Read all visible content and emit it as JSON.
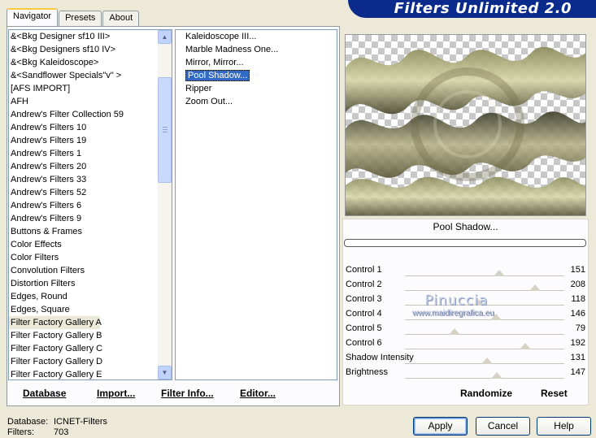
{
  "tabs": [
    "Navigator",
    "Presets",
    "About"
  ],
  "banner_title": "Filters Unlimited 2.0",
  "categories": [
    "&<Bkg Designer sf10 III>",
    "&<Bkg Designers sf10 IV>",
    "&<Bkg Kaleidoscope>",
    "&<Sandflower Specials\"v\" >",
    "[AFS IMPORT]",
    "AFH",
    "Andrew's Filter Collection 59",
    "Andrew's Filters 10",
    "Andrew's Filters 19",
    "Andrew's Filters 1",
    "Andrew's Filters 20",
    "Andrew's Filters 33",
    "Andrew's Filters 52",
    "Andrew's Filters 6",
    "Andrew's Filters 9",
    "Buttons & Frames",
    "Color Effects",
    "Color Filters",
    "Convolution Filters",
    "Distortion Filters",
    "Edges, Round",
    "Edges, Square",
    "Filter Factory Gallery A",
    "Filter Factory Gallery B",
    "Filter Factory Gallery C",
    "Filter Factory Gallery D",
    "Filter Factory Gallery E"
  ],
  "selected_category": "Filter Factory Gallery A",
  "filters": [
    "Kaleidoscope III...",
    "Marble Madness One...",
    "Mirror, Mirror...",
    "Pool Shadow...",
    "Ripper",
    "Zoom Out..."
  ],
  "selected_filter": "Pool Shadow...",
  "bottom_buttons": {
    "database": "Database",
    "import": "Import...",
    "filter_info": "Filter Info...",
    "editor": "Editor..."
  },
  "current_filter_name": "Pool Shadow...",
  "controls": [
    {
      "label": "Control 1",
      "value": 151
    },
    {
      "label": "Control 2",
      "value": 208
    },
    {
      "label": "Control 3",
      "value": 118
    },
    {
      "label": "Control 4",
      "value": 146
    },
    {
      "label": "Control 5",
      "value": 79
    },
    {
      "label": "Control 6",
      "value": 192
    },
    {
      "label": "Shadow Intensity",
      "value": 131
    },
    {
      "label": "Brightness",
      "value": 147
    }
  ],
  "watermark": {
    "name": "Pinuccia",
    "site": "www.maidiregrafica.eu"
  },
  "randomize_label": "Randomize",
  "reset_label": "Reset",
  "status": {
    "database_label": "Database:",
    "database_value": "ICNET-Filters",
    "filters_label": "Filters:",
    "filters_value": "703"
  },
  "dialog_buttons": {
    "apply": "Apply",
    "cancel": "Cancel",
    "help": "Help"
  },
  "colors": {
    "banner": "#0a2a8c",
    "selection": "#316ac5",
    "window": "#ece9d8"
  }
}
